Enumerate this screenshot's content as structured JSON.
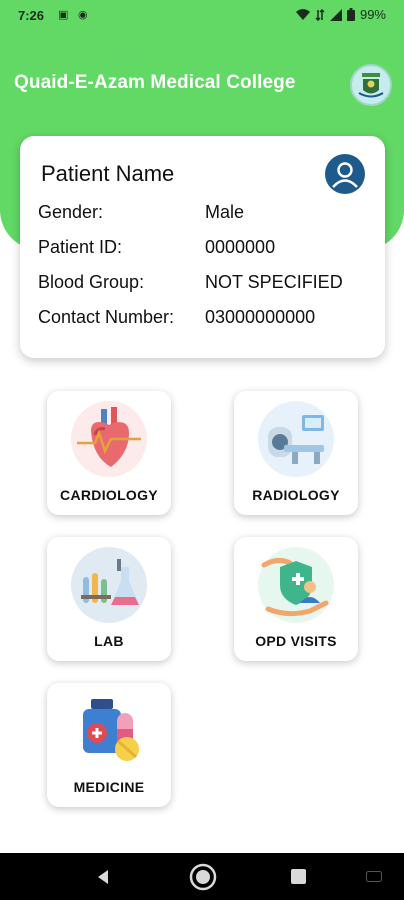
{
  "status_bar": {
    "time": "7:26",
    "battery": "99%"
  },
  "app_bar": {
    "title": "Quaid-E-Azam Medical College"
  },
  "patient": {
    "name": "Patient Name",
    "rows": [
      {
        "label": "Gender:",
        "value": "Male"
      },
      {
        "label": "Patient ID:",
        "value": "0000000"
      },
      {
        "label": "Blood Group:",
        "value": "NOT SPECIFIED"
      },
      {
        "label": "Contact Number:",
        "value": "03000000000"
      }
    ]
  },
  "tiles": [
    {
      "label": "CARDIOLOGY",
      "icon": "heart-icon"
    },
    {
      "label": "RADIOLOGY",
      "icon": "mri-scanner-icon"
    },
    {
      "label": "LAB",
      "icon": "lab-flask-icon"
    },
    {
      "label": "OPD VISITS",
      "icon": "shield-doctor-icon"
    },
    {
      "label": "MEDICINE",
      "icon": "pills-icon"
    }
  ],
  "colors": {
    "primary_green": "#62d965",
    "avatar_blue": "#1f5a8c"
  }
}
